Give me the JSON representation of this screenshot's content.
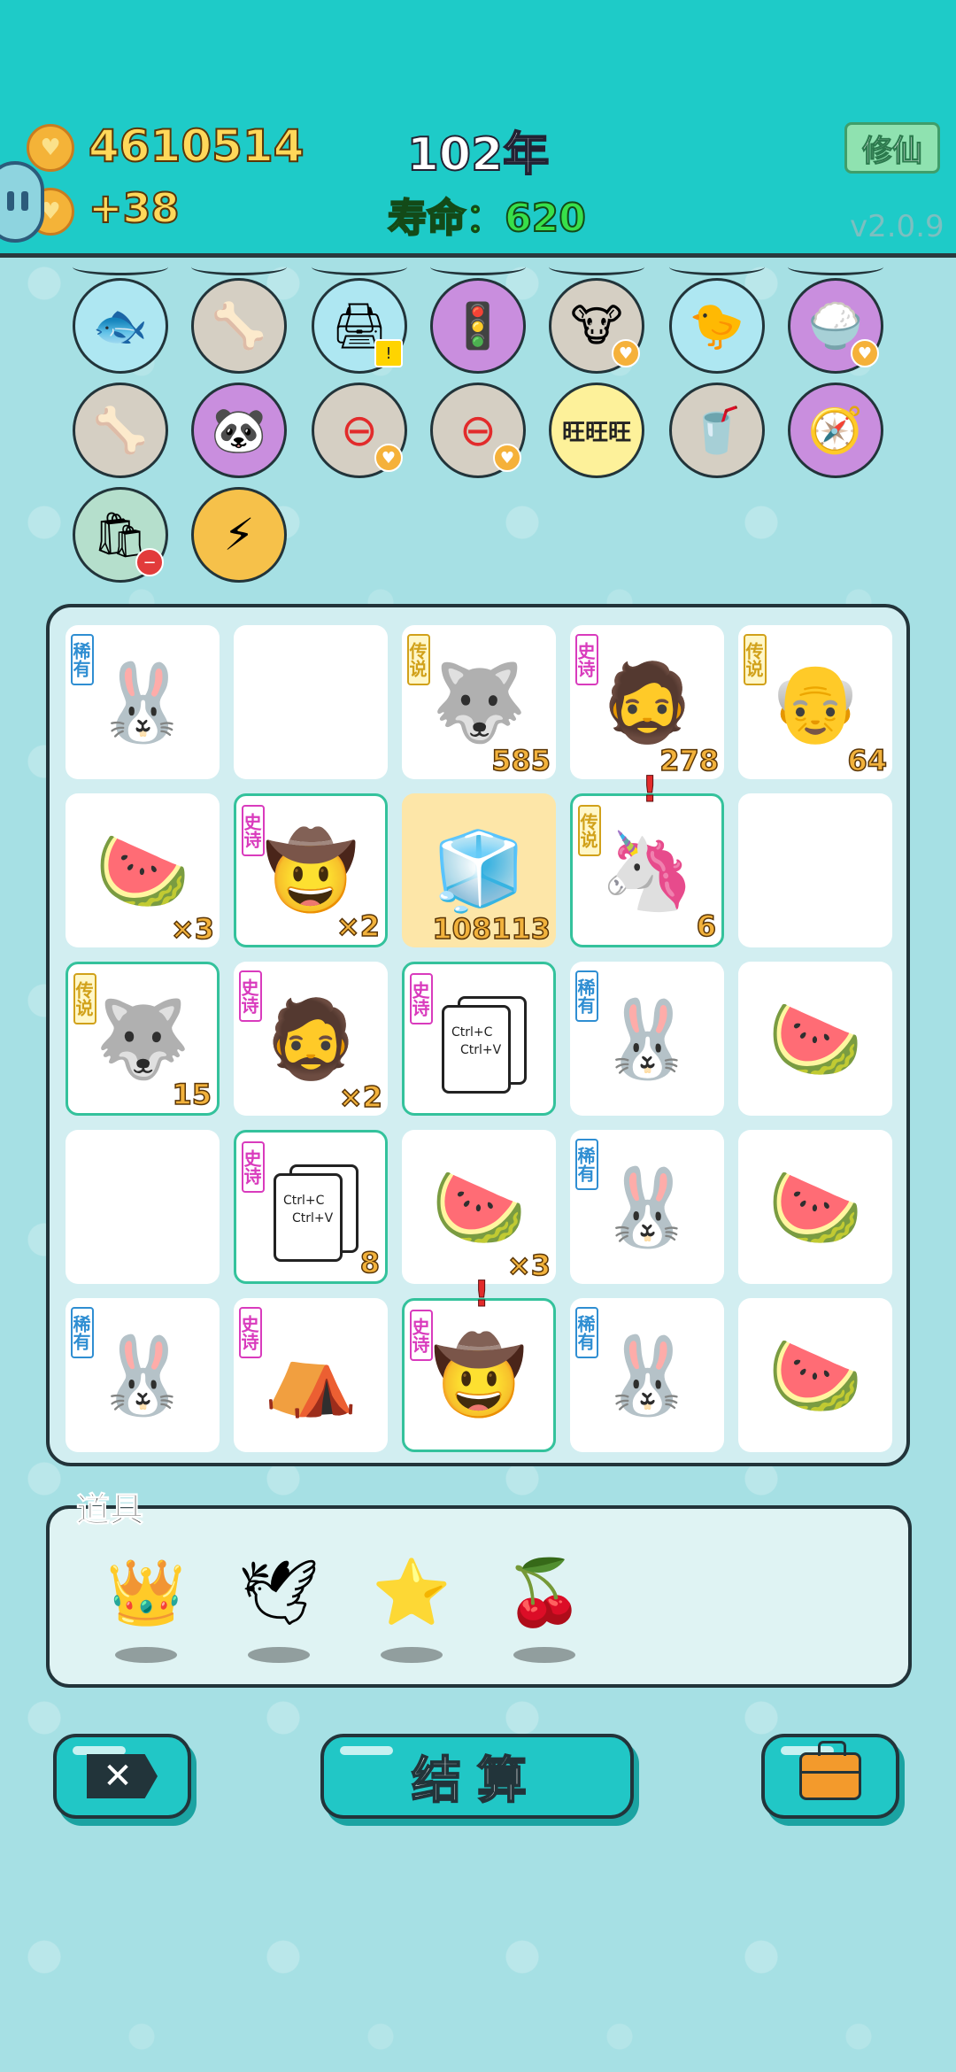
{
  "hud": {
    "gold": "4610514",
    "gold_delta": "+38",
    "year": "102年",
    "lifespan": "寿命：620",
    "cultivate_button": "修仙",
    "version": "v2.0.9"
  },
  "tags": {
    "rare": "稀有",
    "epic": "史诗",
    "legend": "传说"
  },
  "board": {
    "r1c3_count": "585",
    "r1c4_count": "278",
    "r1c5_count": "64",
    "r2c1_count": "×3",
    "r2c2_count": "×2",
    "r2c3_count": "108113",
    "r2c4_count": "6",
    "r3c1_count": "15",
    "r3c2_count": "×2",
    "r4c2_count": "8",
    "r4c3_count": "×3",
    "ctrl_c": "Ctrl+C",
    "ctrl_v": "Ctrl+V",
    "alert": "!"
  },
  "props": {
    "title": "道具"
  },
  "buttons": {
    "settle": "结算",
    "close_symbol": "✕"
  },
  "colors": {
    "hud_bg": "#1ecbc8",
    "page_bg": "#a6e0e4",
    "highlight": "#34c29c"
  }
}
